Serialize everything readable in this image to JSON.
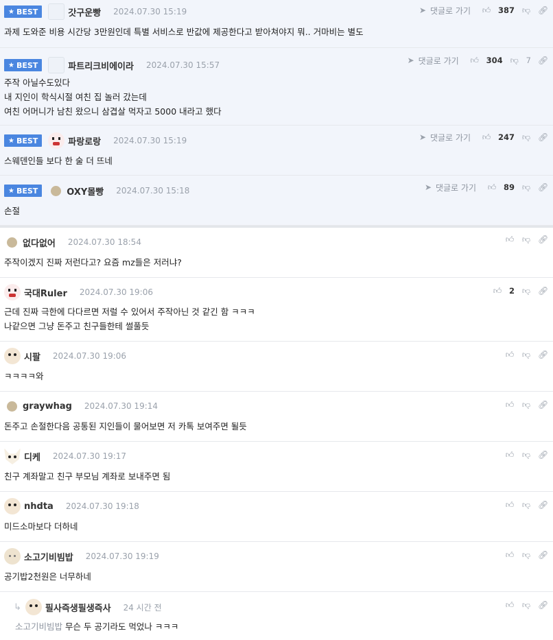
{
  "best_label": "BEST",
  "goto_label": "댓글로 가기",
  "best": [
    {
      "nick": "갓구운빵",
      "date": "2024.07.30 15:19",
      "up": "387",
      "down": "",
      "lines": "과제 도와준 비용 시간당 3만원인데 특별 서비스로 반값에 제공한다고 받아쳐야지 뭐.. 거마비는 별도",
      "avatar": "pic"
    },
    {
      "nick": "파트리크비에이라",
      "date": "2024.07.30 15:57",
      "up": "304",
      "down": "7",
      "lines": "주작 아닐수도있다\n내 지인이 학식시절 여친 집 놀러 갔는데\n여친 어머니가 남친 왔으니 삼겹살 먹자고 5000 내라고 했다",
      "avatar": "pic"
    },
    {
      "nick": "파랑로랑",
      "date": "2024.07.30 15:19",
      "up": "247",
      "down": "",
      "lines": "스웨덴인들 보다 한 술 더 뜨네",
      "avatar": "red"
    },
    {
      "nick": "OXY몰빵",
      "date": "2024.07.30 15:18",
      "up": "89",
      "down": "",
      "lines": "손절",
      "avatar": "dot"
    }
  ],
  "comments": [
    {
      "nick": "없다없어",
      "date": "2024.07.30 18:54",
      "up": "",
      "lines": "주작이겠지 진짜 저런다고? 요즘 mz들은 저러냐?",
      "avatar": "dot"
    },
    {
      "nick": "국대Ruler",
      "date": "2024.07.30 19:06",
      "up": "2",
      "lines": "근데 진짜 극한에 다다르면 저럴 수 있어서 주작아닌 것 같긴 함 ㅋㅋㅋ\n나같으면 그냥 돈주고 친구들한테 썰풀듯",
      "avatar": "red"
    },
    {
      "nick": "시팔",
      "date": "2024.07.30 19:06",
      "up": "",
      "lines": "ㅋㅋㅋㅋ와",
      "avatar": "dog"
    },
    {
      "nick": "graywhag",
      "date": "2024.07.30 19:14",
      "up": "",
      "lines": "돈주고 손절한다음 공통된 지인들이 물어보면 저 카톡 보여주면 될듯",
      "avatar": "dot"
    },
    {
      "nick": "디케",
      "date": "2024.07.30 19:17",
      "up": "",
      "lines": "친구 계좌말고 친구 부모님 계좌로 보내주면 됨",
      "avatar": "fox"
    },
    {
      "nick": "nhdta",
      "date": "2024.07.30 19:18",
      "up": "",
      "lines": "미드소마보다 더하네",
      "avatar": "dog"
    },
    {
      "nick": "소고기비빔밥",
      "date": "2024.07.30 19:19",
      "up": "",
      "lines": "공기밥2천원은 너무하네",
      "avatar": "pale"
    }
  ],
  "reply": {
    "nick": "필사즉생필생즉사",
    "date": "24 시간 전",
    "mention": "소고기비빔밥",
    "text": "무슨 두 공기라도 먹었나 ㅋㅋㅋ"
  },
  "icons": {
    "up": "thumbs-up-icon",
    "down": "thumbs-down-icon",
    "share": "link-icon",
    "goto": "arrow-icon"
  }
}
